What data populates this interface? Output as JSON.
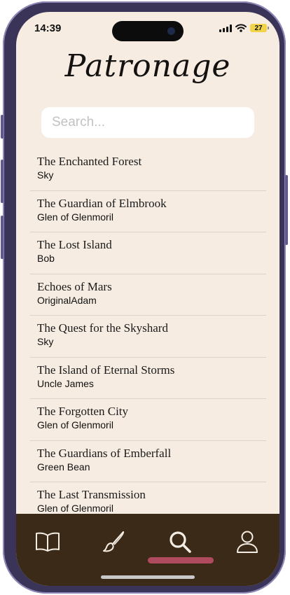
{
  "status_bar": {
    "time": "14:39",
    "battery": "27"
  },
  "app": {
    "title": "Patronage"
  },
  "search": {
    "placeholder": "Search...",
    "value": ""
  },
  "stories": [
    {
      "title": "The Enchanted Forest",
      "author": "Sky"
    },
    {
      "title": "The Guardian of Elmbrook",
      "author": "Glen of Glenmoril"
    },
    {
      "title": "The Lost Island",
      "author": "Bob"
    },
    {
      "title": "Echoes of Mars",
      "author": "OriginalAdam"
    },
    {
      "title": "The Quest for the Skyshard",
      "author": "Sky"
    },
    {
      "title": "The Island of Eternal Storms",
      "author": "Uncle James"
    },
    {
      "title": "The Forgotten City",
      "author": "Glen of Glenmoril"
    },
    {
      "title": "The Guardians of Emberfall",
      "author": "Green Bean"
    },
    {
      "title": "The Last Transmission",
      "author": "Glen of Glenmoril"
    }
  ],
  "tab_bar": {
    "tabs": [
      {
        "icon": "book-icon"
      },
      {
        "icon": "brush-icon"
      },
      {
        "icon": "search-icon",
        "active": true
      },
      {
        "icon": "profile-icon"
      }
    ],
    "active_index": 2
  },
  "colors": {
    "background": "#f6ece2",
    "tab_bar": "#3b2a17",
    "accent": "#b04a5e",
    "device_frame": "#3a3558"
  }
}
